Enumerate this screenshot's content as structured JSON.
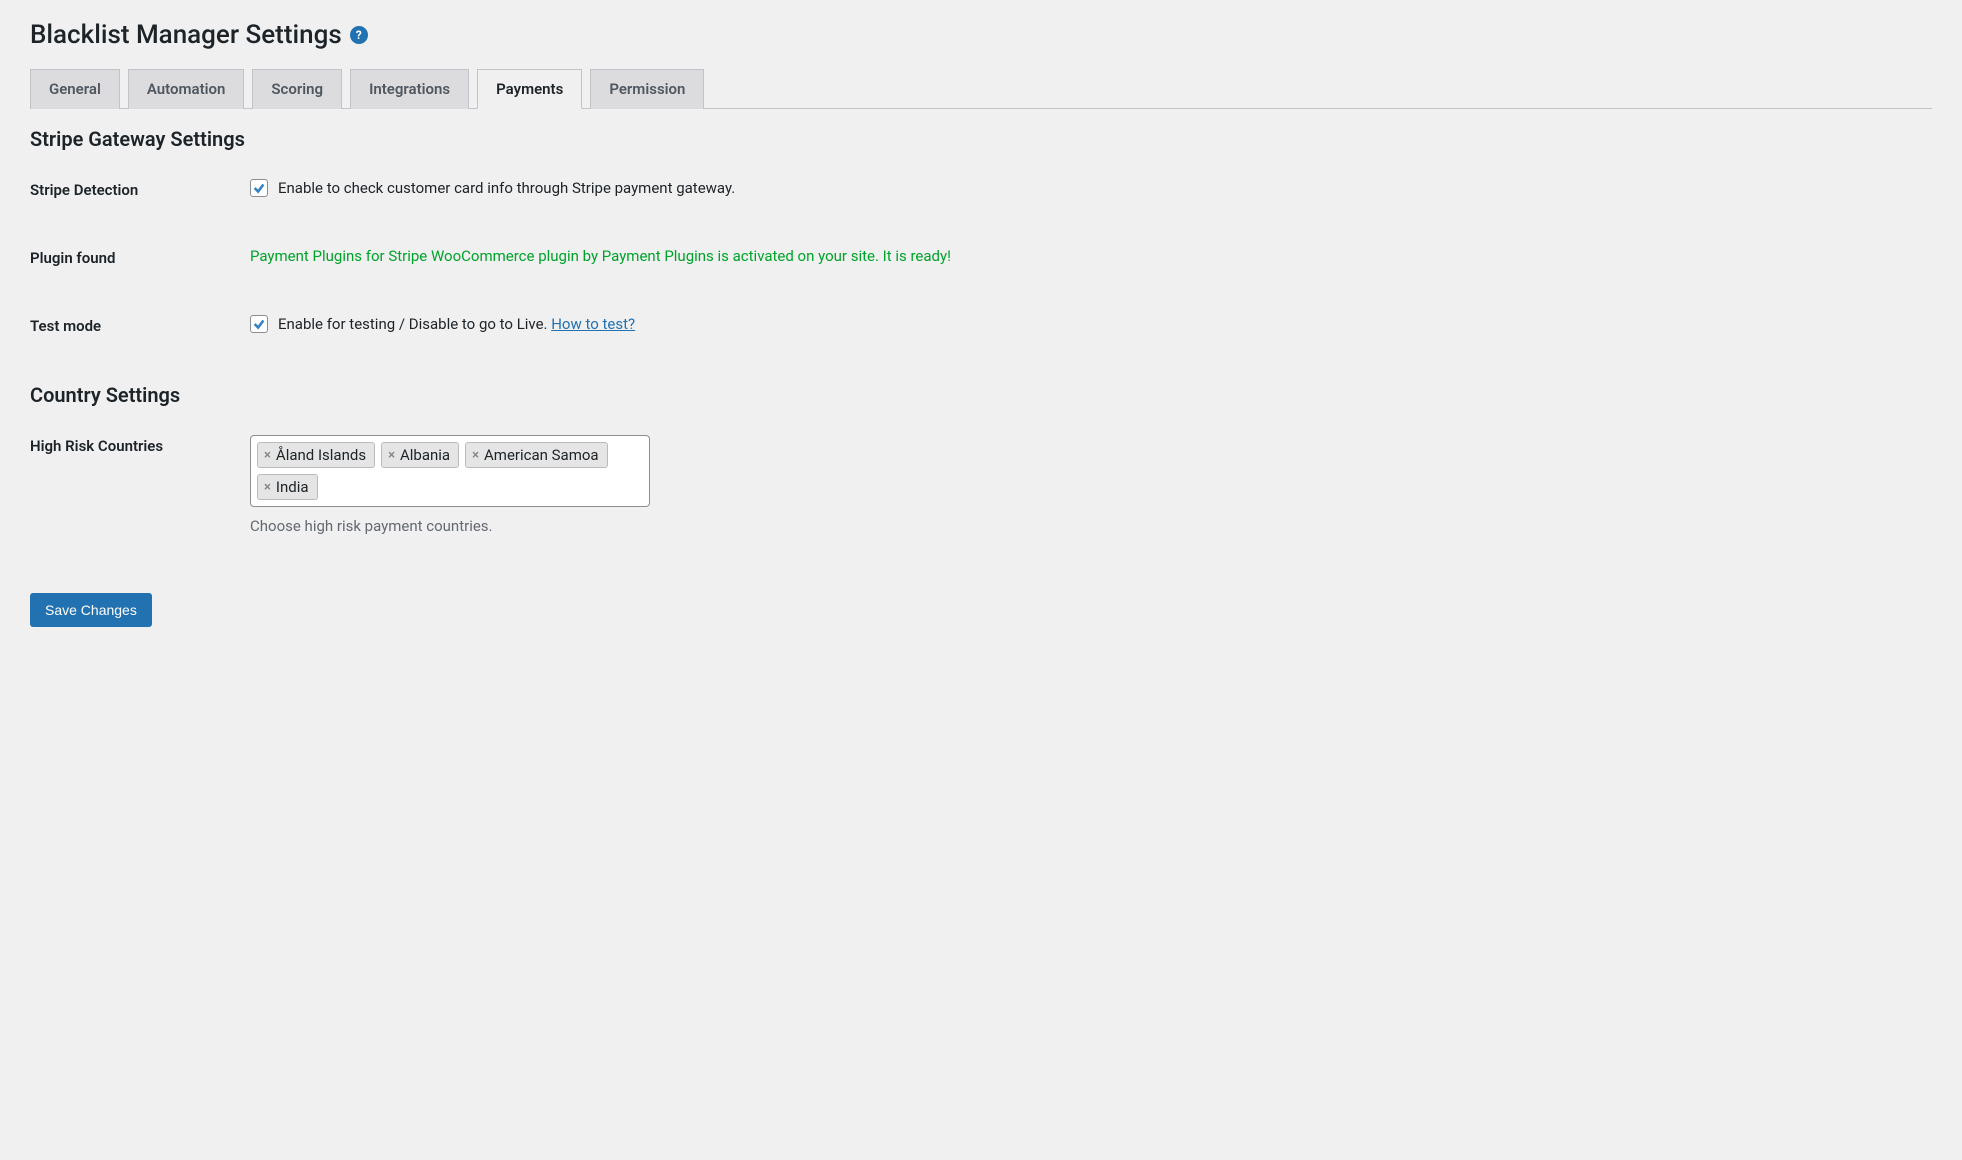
{
  "page_title": "Blacklist Manager Settings",
  "tabs": {
    "general": "General",
    "automation": "Automation",
    "scoring": "Scoring",
    "integrations": "Integrations",
    "payments": "Payments",
    "permission": "Permission"
  },
  "sections": {
    "stripe_heading": "Stripe Gateway Settings",
    "country_heading": "Country Settings"
  },
  "stripe_detection": {
    "label": "Stripe Detection",
    "text": "Enable to check customer card info through Stripe payment gateway."
  },
  "plugin_found": {
    "label": "Plugin found",
    "text": "Payment Plugins for Stripe WooCommerce plugin by Payment Plugins is activated on your site. It is ready!"
  },
  "test_mode": {
    "label": "Test mode",
    "text": "Enable for testing / Disable to go to Live. ",
    "link": "How to test?"
  },
  "high_risk": {
    "label": "High Risk Countries",
    "tags": [
      "Åland Islands",
      "Albania",
      "American Samoa",
      "India"
    ],
    "help": "Choose high risk payment countries."
  },
  "save_button": "Save Changes"
}
